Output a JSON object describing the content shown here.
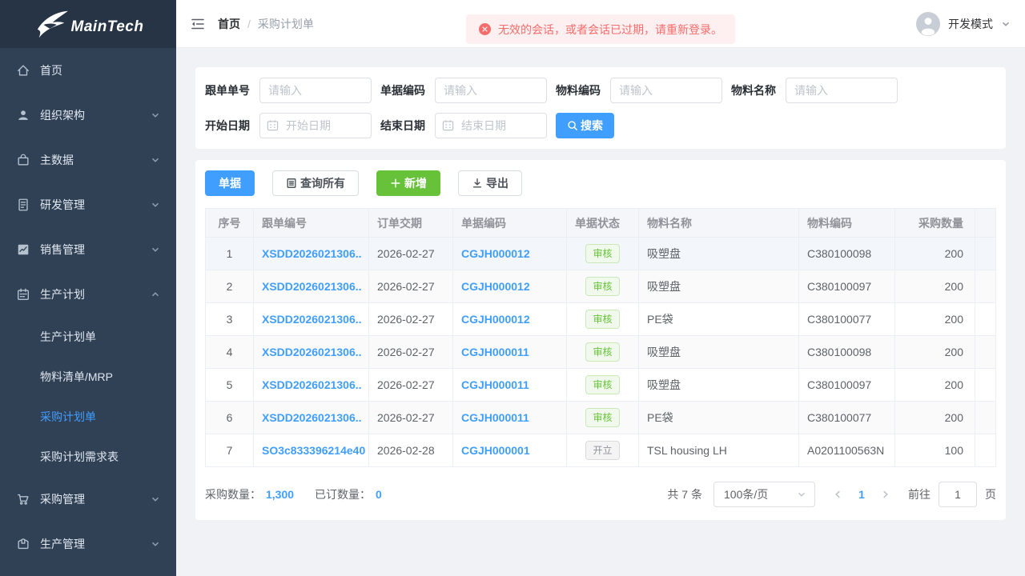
{
  "app": {
    "logo_text": "MainTech"
  },
  "colors": {
    "primary": "#409eff",
    "success": "#67c23a",
    "danger": "#f56c6c",
    "sidebar_bg": "#304156",
    "logo_bg": "#263445"
  },
  "sidebar": {
    "items": [
      {
        "id": "home",
        "label": "首页",
        "icon": "home-icon",
        "expandable": false
      },
      {
        "id": "org",
        "label": "组织架构",
        "icon": "user-icon",
        "expandable": true
      },
      {
        "id": "master-data",
        "label": "主数据",
        "icon": "bag-icon",
        "expandable": true
      },
      {
        "id": "rd-management",
        "label": "研发管理",
        "icon": "document-icon",
        "expandable": true
      },
      {
        "id": "sales-management",
        "label": "销售管理",
        "icon": "chart-icon",
        "expandable": true
      },
      {
        "id": "production-plan",
        "label": "生产计划",
        "icon": "calendar-icon",
        "expandable": true,
        "expanded": true,
        "children": [
          {
            "id": "production-plan-order",
            "label": "生产计划单",
            "active": false
          },
          {
            "id": "bom-mrp",
            "label": "物料清单/MRP",
            "active": false
          },
          {
            "id": "purchase-plan-order",
            "label": "采购计划单",
            "active": true
          },
          {
            "id": "purchase-plan-demand",
            "label": "采购计划需求表",
            "active": false
          }
        ]
      },
      {
        "id": "purchase-management",
        "label": "采购管理",
        "icon": "cart-icon",
        "expandable": true
      },
      {
        "id": "production-management",
        "label": "生产管理",
        "icon": "box-icon",
        "expandable": true
      }
    ]
  },
  "topbar": {
    "breadcrumb": {
      "home": "首页",
      "separator": "/",
      "current": "采购计划单"
    },
    "alert_message": "无效的会话，或者会话已过期，请重新登录。",
    "user_name": "开发模式"
  },
  "filters": {
    "fields": [
      {
        "label": "跟单单号",
        "placeholder": "请输入",
        "type": "text"
      },
      {
        "label": "单据编码",
        "placeholder": "请输入",
        "type": "text"
      },
      {
        "label": "物料编码",
        "placeholder": "请输入",
        "type": "text"
      },
      {
        "label": "物料名称",
        "placeholder": "请输入",
        "type": "text"
      },
      {
        "label": "开始日期",
        "placeholder": "开始日期",
        "type": "date"
      },
      {
        "label": "结束日期",
        "placeholder": "结束日期",
        "type": "date"
      }
    ],
    "search_label": "搜索"
  },
  "toolbar": {
    "bill": "单据",
    "query_all": "查询所有",
    "add": "新增",
    "export": "导出"
  },
  "table": {
    "columns": [
      "序号",
      "跟单编号",
      "订单交期",
      "单据编码",
      "单据状态",
      "物料名称",
      "物料编码",
      "采购数量",
      ""
    ],
    "rows": [
      {
        "index": "1",
        "follow_no": "XSDD2026021306..",
        "delivery_date": "2026-02-27",
        "doc_no": "CGJH000012",
        "status": "审核",
        "status_type": "success",
        "material_name": "吸塑盘",
        "material_code": "C380100098",
        "qty": "200",
        "highlight": true
      },
      {
        "index": "2",
        "follow_no": "XSDD2026021306..",
        "delivery_date": "2026-02-27",
        "doc_no": "CGJH000012",
        "status": "审核",
        "status_type": "success",
        "material_name": "吸塑盘",
        "material_code": "C380100097",
        "qty": "200"
      },
      {
        "index": "3",
        "follow_no": "XSDD2026021306..",
        "delivery_date": "2026-02-27",
        "doc_no": "CGJH000012",
        "status": "审核",
        "status_type": "success",
        "material_name": "PE袋",
        "material_code": "C380100077",
        "qty": "200"
      },
      {
        "index": "4",
        "follow_no": "XSDD2026021306..",
        "delivery_date": "2026-02-27",
        "doc_no": "CGJH000011",
        "status": "审核",
        "status_type": "success",
        "material_name": "吸塑盘",
        "material_code": "C380100098",
        "qty": "200"
      },
      {
        "index": "5",
        "follow_no": "XSDD2026021306..",
        "delivery_date": "2026-02-27",
        "doc_no": "CGJH000011",
        "status": "审核",
        "status_type": "success",
        "material_name": "吸塑盘",
        "material_code": "C380100097",
        "qty": "200"
      },
      {
        "index": "6",
        "follow_no": "XSDD2026021306..",
        "delivery_date": "2026-02-27",
        "doc_no": "CGJH000011",
        "status": "审核",
        "status_type": "success",
        "material_name": "PE袋",
        "material_code": "C380100077",
        "qty": "200"
      },
      {
        "index": "7",
        "follow_no": "SO3c833396214e40",
        "delivery_date": "2026-02-28",
        "doc_no": "CGJH000001",
        "status": "开立",
        "status_type": "info",
        "material_name": "TSL housing LH",
        "material_code": "A0201100563N",
        "qty": "100"
      }
    ]
  },
  "summary": {
    "purchase_qty_label": "采购数量：",
    "purchase_qty": "1,300",
    "ordered_qty_label": "已订数量：",
    "ordered_qty": "0"
  },
  "pagination": {
    "total": "共 7 条",
    "page_size": "100条/页",
    "current_page": "1",
    "goto_label": "前往",
    "goto_value": "1",
    "page_suffix": "页"
  }
}
